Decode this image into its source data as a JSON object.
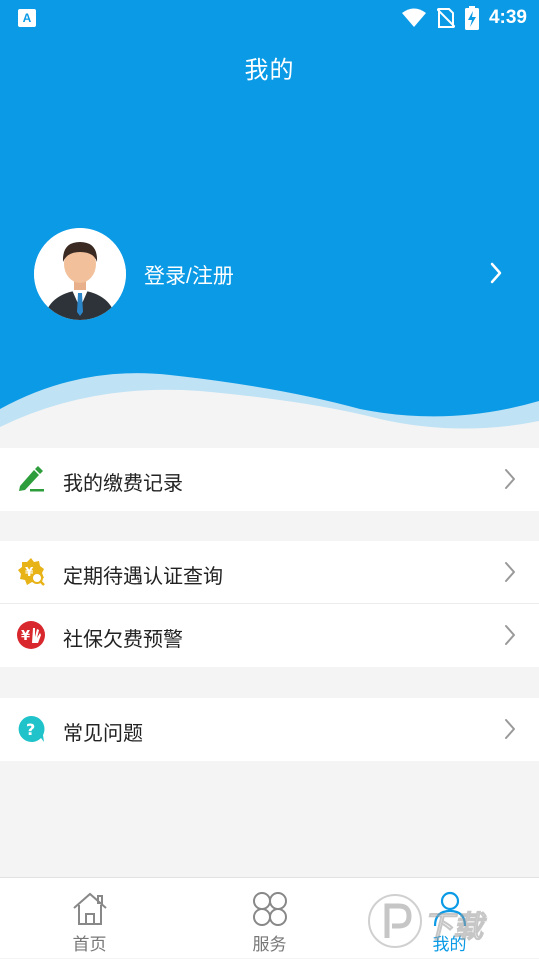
{
  "statusbar": {
    "app_icon_letter": "A",
    "time": "4:39"
  },
  "header": {
    "title": "我的",
    "login_label": "登录/注册"
  },
  "menu": {
    "group1": [
      {
        "label": "我的缴费记录",
        "icon": "edit-pen-icon"
      }
    ],
    "group2": [
      {
        "label": "定期待遇认证查询",
        "icon": "yuan-search-badge-icon"
      },
      {
        "label": "社保欠费预警",
        "icon": "yuan-hand-warning-icon"
      }
    ],
    "group3": [
      {
        "label": "常见问题",
        "icon": "question-bubble-icon"
      }
    ]
  },
  "tabbar": {
    "tabs": [
      {
        "label": "首页",
        "icon": "home-icon",
        "active": false
      },
      {
        "label": "服务",
        "icon": "grid-services-icon",
        "active": false
      },
      {
        "label": "我的",
        "icon": "person-icon",
        "active": true
      }
    ]
  },
  "watermark": {
    "text": "下载"
  },
  "colors": {
    "primary": "#0a9ae6",
    "background": "#f4f4f4",
    "icon_green": "#2e9e3c",
    "icon_gold": "#e8b317",
    "icon_red": "#d8282e",
    "icon_teal": "#1fc3c9"
  }
}
